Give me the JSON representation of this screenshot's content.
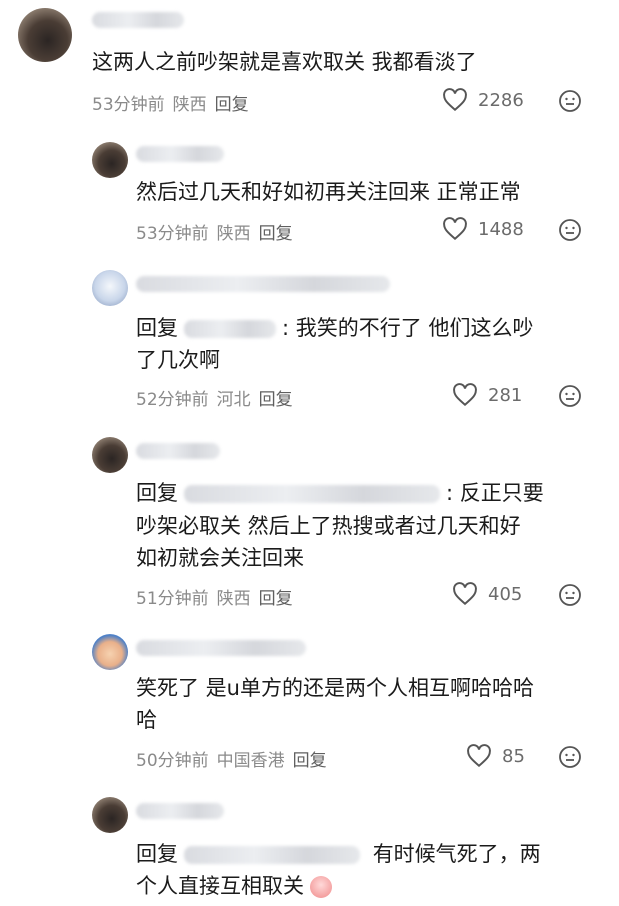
{
  "comments": [
    {
      "text": "这两人之前吵架就是喜欢取关 我都看淡了",
      "time": "53分钟前",
      "location": "陕西",
      "reply": "回复",
      "likes": "2286"
    },
    {
      "text": "然后过几天和好如初再关注回来 正常正常",
      "time": "53分钟前",
      "location": "陕西",
      "reply": "回复",
      "likes": "1488"
    },
    {
      "prefix": "回复",
      "sep": ":",
      "text1": "我笑的不行了 他们这么吵",
      "text2": "了几次啊",
      "time": "52分钟前",
      "location": "河北",
      "reply": "回复",
      "likes": "281"
    },
    {
      "prefix": "回复",
      "sep": ":",
      "text1": "反正只要",
      "text2": "吵架必取关 然后上了热搜或者过几天和好",
      "text3": "如初就会关注回来",
      "time": "51分钟前",
      "location": "陕西",
      "reply": "回复",
      "likes": "405"
    },
    {
      "text1": "笑死了 是u单方的还是两个人相互啊哈哈哈",
      "text2": "哈",
      "time": "50分钟前",
      "location": "中国香港",
      "reply": "回复",
      "likes": "85"
    },
    {
      "prefix": "回复",
      "text1": "有时候气死了，两",
      "text2": "个人直接互相取关"
    }
  ]
}
